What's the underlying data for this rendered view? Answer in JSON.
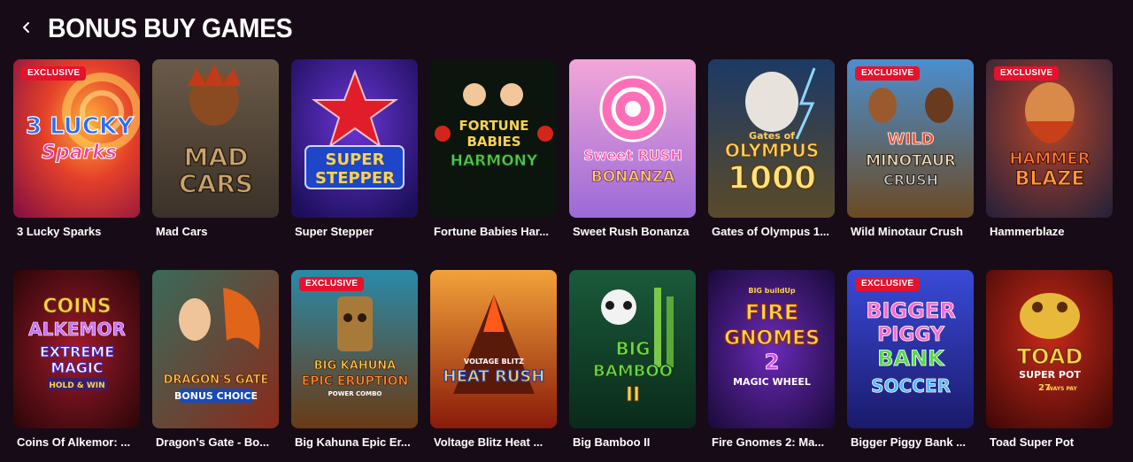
{
  "header": {
    "title": "BONUS BUY GAMES",
    "back_icon": "chevron-left-icon"
  },
  "colors": {
    "background": "#170b17",
    "badge": "#e5122b",
    "text": "#ffffff"
  },
  "games": [
    {
      "name": "3 Lucky Sparks",
      "badge": "EXCLUSIVE",
      "art": [
        "3 LUCKY",
        "Sparks"
      ]
    },
    {
      "name": "Mad Cars",
      "badge": "",
      "art": [
        "MAD",
        "CARS"
      ]
    },
    {
      "name": "Super Stepper",
      "badge": "",
      "art": [
        "SUPER",
        "STEPPER"
      ]
    },
    {
      "name": "Fortune Babies Har...",
      "badge": "",
      "art": [
        "FORTUNE",
        "BABIES",
        "HARMONY"
      ]
    },
    {
      "name": "Sweet Rush Bonanza",
      "badge": "",
      "art": [
        "Sweet RUSH",
        "BONANZA"
      ]
    },
    {
      "name": "Gates of Olympus 1...",
      "badge": "",
      "art": [
        "Gates of",
        "OLYMPUS",
        "1000"
      ]
    },
    {
      "name": "Wild Minotaur Crush",
      "badge": "EXCLUSIVE",
      "art": [
        "WILD",
        "MINOTAUR",
        "CRUSH"
      ]
    },
    {
      "name": "Hammerblaze",
      "badge": "EXCLUSIVE",
      "art": [
        "HAMMER",
        "BLAZE"
      ]
    },
    {
      "name": "Coins Of Alkemor: ...",
      "badge": "",
      "art": [
        "COINS",
        "ALKEMOR",
        "EXTREME",
        "MAGIC",
        "HOLD & WIN"
      ]
    },
    {
      "name": "Dragon's Gate - Bo...",
      "badge": "",
      "art": [
        "DRAGON'S GATE",
        "BONUS CHOICE"
      ]
    },
    {
      "name": "Big Kahuna Epic Er...",
      "badge": "EXCLUSIVE",
      "art": [
        "BIG KAHUNA",
        "EPIC ERUPTION",
        "POWER COMBO"
      ]
    },
    {
      "name": "Voltage Blitz Heat ...",
      "badge": "",
      "art": [
        "VOLTAGE BLITZ",
        "HEAT RUSH"
      ]
    },
    {
      "name": "Big Bamboo II",
      "badge": "",
      "art": [
        "BIG",
        "BAMBOO",
        "II"
      ]
    },
    {
      "name": "Fire Gnomes 2: Ma...",
      "badge": "",
      "art": [
        "BIG buildUp",
        "FIRE",
        "GNOMES",
        "2",
        "MAGIC WHEEL"
      ]
    },
    {
      "name": "Bigger Piggy Bank ...",
      "badge": "EXCLUSIVE",
      "art": [
        "BIGGER",
        "PIGGY",
        "BANK",
        "SOCCER"
      ]
    },
    {
      "name": "Toad Super Pot",
      "badge": "",
      "art": [
        "TOAD",
        "SUPER POT",
        "27",
        "WAYS PAY"
      ]
    }
  ]
}
